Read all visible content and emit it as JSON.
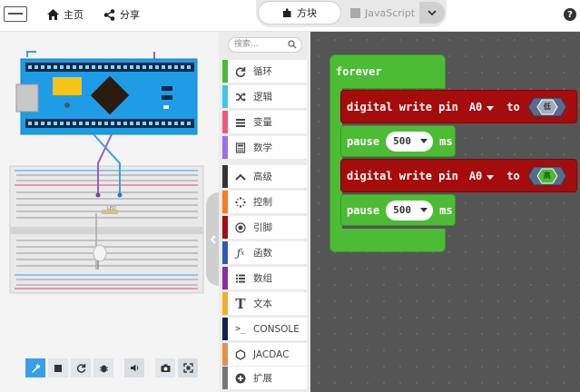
{
  "header": {
    "home_label": "主页",
    "share_label": "分享",
    "blocks_tab": "方块",
    "js_tab": "JavaScript",
    "help": "?"
  },
  "toolbox": {
    "search_placeholder": "搜索...",
    "categories": [
      {
        "label": "循环",
        "color": "#4cbc34",
        "icon": "refresh-icon"
      },
      {
        "label": "逻辑",
        "color": "#3cc8e8",
        "icon": "shuffle-icon"
      },
      {
        "label": "变量",
        "color": "#f0587b",
        "icon": "list-icon"
      },
      {
        "label": "数学",
        "color": "#9a6ef0",
        "icon": "calculator-icon"
      },
      {
        "label": "高级",
        "color": "#333333",
        "icon": "chevron-up-icon"
      },
      {
        "label": "控制",
        "color": "#ff7a1a",
        "icon": "spinner-icon"
      },
      {
        "label": "引脚",
        "color": "#a50c0c",
        "icon": "target-icon"
      },
      {
        "label": "函数",
        "color": "#2a5ab8",
        "icon": "function-icon"
      },
      {
        "label": "数组",
        "color": "#8a2ba8",
        "icon": "array-icon"
      },
      {
        "label": "文本",
        "color": "#f0b028",
        "icon": "text-icon"
      },
      {
        "label": "CONSOLE",
        "color": "#112255",
        "icon": "terminal-icon"
      },
      {
        "label": "JACDAC",
        "color": "#e8904a",
        "icon": "jacdac-icon"
      },
      {
        "label": "扩展",
        "color": "#777777",
        "icon": "plus-circle-icon"
      }
    ]
  },
  "workspace": {
    "forever_label": "forever",
    "block1": {
      "text": "digital write pin",
      "pin": "A0",
      "to": "to",
      "value": "低"
    },
    "pause1": {
      "label": "pause",
      "value": "500",
      "unit": "ms"
    },
    "block2": {
      "text": "digital write pin",
      "pin": "A0",
      "to": "to",
      "value": "高"
    },
    "pause2": {
      "label": "pause",
      "value": "500",
      "unit": "ms"
    }
  },
  "simulator": {
    "led_label": "LED"
  },
  "colors": {
    "loops": "#4cbc34",
    "pins": "#a50c0c",
    "workspace_bg": "#555555",
    "accent": "#3aa0e6"
  }
}
